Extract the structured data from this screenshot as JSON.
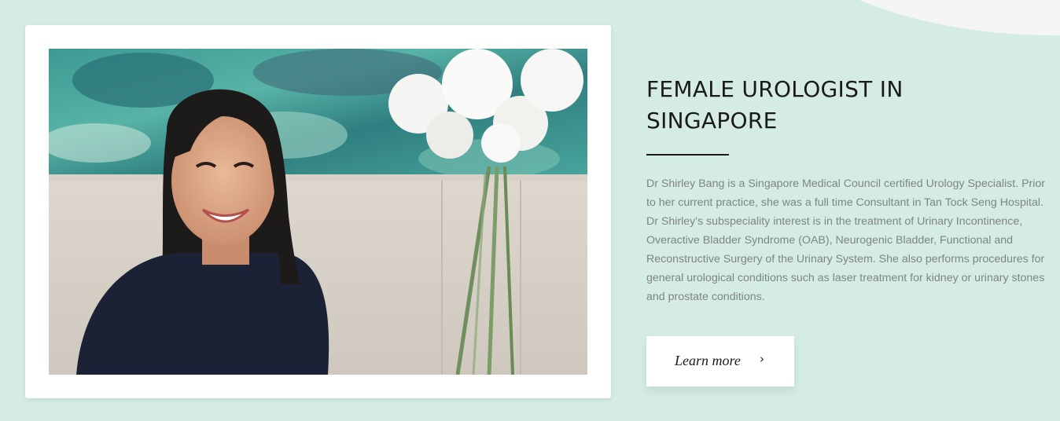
{
  "section": {
    "title_lines": [
      "FEMALE UROLOGIST IN",
      "SINGAPORE"
    ],
    "description": "Dr Shirley Bang is a Singapore Medical Council certified Urology Specialist. Prior to her current practice, she was a full time Consultant in Tan Tock Seng Hospital. Dr Shirley's subspeciality interest is in the treatment of Urinary Incontinence, Overactive Bladder Syndrome (OAB), Neurogenic Bladder, Functional and Reconstructive Surgery of the Urinary System. She also performs procedures for general urological conditions such as laser treatment for kidney or urinary stones and prostate conditions.",
    "cta_label": "Learn more",
    "cta_icon": "chevron-right-icon"
  },
  "colors": {
    "background": "#d5ece5",
    "card": "#ffffff",
    "title": "#1a1a1a",
    "body_text": "#7e8582",
    "accent_shape": "#f4f5f4"
  }
}
